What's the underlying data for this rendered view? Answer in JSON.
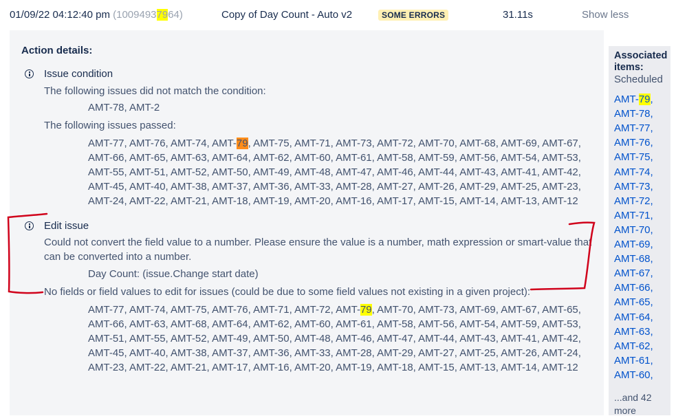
{
  "header": {
    "timestamp": "01/09/22 04:12:40 pm",
    "id_open": "(1009493",
    "id_highlight": "79",
    "id_close": "64)",
    "rule_name": "Copy of Day Count - Auto v2",
    "status": "SOME ERRORS",
    "duration": "31.11s",
    "toggle": "Show less"
  },
  "details": {
    "title": "Action details:",
    "condition": {
      "heading": "Issue condition",
      "not_matched_label": "The following issues did not match the condition:",
      "not_matched": "AMT-78, AMT-2",
      "passed_label": "The following issues passed:",
      "passed_lines": [
        {
          "pre": "AMT-77, AMT-76, AMT-74, AMT-",
          "hl": "79",
          "post": ", AMT-75, AMT-71, AMT-73, AMT-72, AMT-70, AMT-68, AMT-69, AMT-67,"
        },
        {
          "pre": "AMT-66, AMT-65, AMT-63, AMT-64, AMT-62, AMT-60, AMT-61, AMT-58, AMT-59, AMT-56, AMT-54, AMT-53,",
          "hl": "",
          "post": ""
        },
        {
          "pre": "AMT-55, AMT-51, AMT-52, AMT-50, AMT-49, AMT-48, AMT-47, AMT-46, AMT-44, AMT-43, AMT-41, AMT-42,",
          "hl": "",
          "post": ""
        },
        {
          "pre": "AMT-45, AMT-40, AMT-38, AMT-37, AMT-36, AMT-33, AMT-28, AMT-27, AMT-26, AMT-29, AMT-25, AMT-23,",
          "hl": "",
          "post": ""
        },
        {
          "pre": "AMT-24, AMT-22, AMT-21, AMT-18, AMT-19, AMT-20, AMT-16, AMT-17, AMT-15, AMT-14, AMT-13, AMT-12",
          "hl": "",
          "post": ""
        }
      ]
    },
    "edit": {
      "heading": "Edit issue",
      "error_line1": "Could not convert the field value to a number. Please ensure the value is a number, math expression or smart-value that",
      "error_line2": "can be converted into a number.",
      "field": "Day Count: (issue.Change start date)",
      "nofields_label": "No fields or field values to edit for issues (could be due to some field values not existing in a given project):",
      "issue_lines": [
        {
          "pre": "AMT-77, AMT-74, AMT-75, AMT-76, AMT-71, AMT-72, AMT-",
          "hl": "79",
          "post": ", AMT-70, AMT-73, AMT-69, AMT-67, AMT-65,"
        },
        {
          "pre": "AMT-66, AMT-63, AMT-68, AMT-64, AMT-62, AMT-60, AMT-61, AMT-58, AMT-56, AMT-54, AMT-59, AMT-53,",
          "hl": "",
          "post": ""
        },
        {
          "pre": "AMT-51, AMT-55, AMT-52, AMT-49, AMT-50, AMT-48, AMT-46, AMT-47, AMT-44, AMT-43, AMT-41, AMT-42,",
          "hl": "",
          "post": ""
        },
        {
          "pre": "AMT-45, AMT-40, AMT-38, AMT-37, AMT-36, AMT-33, AMT-28, AMT-29, AMT-27, AMT-25, AMT-26, AMT-24,",
          "hl": "",
          "post": ""
        },
        {
          "pre": "AMT-23, AMT-22, AMT-21, AMT-17, AMT-16, AMT-20, AMT-19, AMT-18, AMT-15, AMT-13, AMT-14, AMT-12",
          "hl": "",
          "post": ""
        }
      ]
    }
  },
  "associated": {
    "title_line1": "Associated",
    "title_line2": "items:",
    "subtitle": "Scheduled",
    "items": [
      {
        "pre": "AMT-",
        "hl": "79",
        "post": ","
      },
      {
        "pre": "AMT-78,",
        "hl": "",
        "post": ""
      },
      {
        "pre": "AMT-77,",
        "hl": "",
        "post": ""
      },
      {
        "pre": "AMT-76,",
        "hl": "",
        "post": ""
      },
      {
        "pre": "AMT-75,",
        "hl": "",
        "post": ""
      },
      {
        "pre": "AMT-74,",
        "hl": "",
        "post": ""
      },
      {
        "pre": "AMT-73,",
        "hl": "",
        "post": ""
      },
      {
        "pre": "AMT-72,",
        "hl": "",
        "post": ""
      },
      {
        "pre": "AMT-71,",
        "hl": "",
        "post": ""
      },
      {
        "pre": "AMT-70,",
        "hl": "",
        "post": ""
      },
      {
        "pre": "AMT-69,",
        "hl": "",
        "post": ""
      },
      {
        "pre": "AMT-68,",
        "hl": "",
        "post": ""
      },
      {
        "pre": "AMT-67,",
        "hl": "",
        "post": ""
      },
      {
        "pre": "AMT-66,",
        "hl": "",
        "post": ""
      },
      {
        "pre": "AMT-65,",
        "hl": "",
        "post": ""
      },
      {
        "pre": "AMT-64,",
        "hl": "",
        "post": ""
      },
      {
        "pre": "AMT-63,",
        "hl": "",
        "post": ""
      },
      {
        "pre": "AMT-62,",
        "hl": "",
        "post": ""
      },
      {
        "pre": "AMT-61,",
        "hl": "",
        "post": ""
      },
      {
        "pre": "AMT-60,",
        "hl": "",
        "post": ""
      }
    ],
    "more_line1": "...and 42",
    "more_line2": "more"
  },
  "colors": {
    "highlight": "#ffff00",
    "highlight_active": "#ff8c1a",
    "annotation": "#d0021b",
    "link": "#0052cc"
  }
}
